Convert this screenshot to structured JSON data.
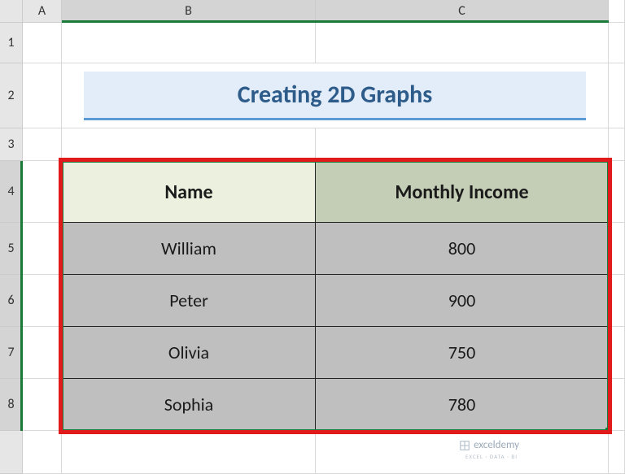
{
  "columns": {
    "blank": "",
    "A": "A",
    "B": "B",
    "C": "C"
  },
  "rows": {
    "1": "1",
    "2": "2",
    "3": "3",
    "4": "4",
    "5": "5",
    "6": "6",
    "7": "7",
    "8": "8"
  },
  "title": "Creating 2D Graphs",
  "table": {
    "headers": {
      "name": "Name",
      "income": "Monthly Income"
    },
    "rows": [
      {
        "name": "William",
        "income": "800"
      },
      {
        "name": "Peter",
        "income": "900"
      },
      {
        "name": "Olivia",
        "income": "750"
      },
      {
        "name": "Sophia",
        "income": "780"
      }
    ]
  },
  "watermark": {
    "brand": "exceldemy",
    "tagline": "EXCEL · DATA · BI"
  }
}
